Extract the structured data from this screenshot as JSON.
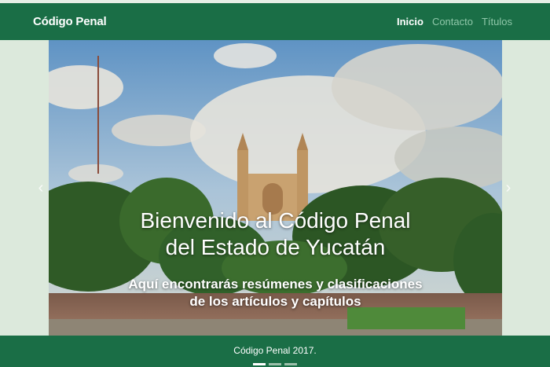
{
  "navbar": {
    "brand": "Código Penal",
    "links": [
      {
        "label": "Inicio",
        "active": true
      },
      {
        "label": "Contacto",
        "active": false
      },
      {
        "label": "Títulos",
        "active": false
      }
    ]
  },
  "carousel": {
    "title_line1": "Bienvenido al Código Penal",
    "title_line2": "del Estado de Yucatán",
    "subtitle_line1": "Aquí encontrarás resúmenes y clasificaciones",
    "subtitle_line2": "de los artículos y capítulos",
    "prev_icon": "‹",
    "next_icon": "›",
    "slide_count": 3,
    "active_slide": 1
  },
  "footer": {
    "text": "Código Penal 2017."
  },
  "colors": {
    "primary": "#1a6e46",
    "background": "#dce9dc",
    "nav_inactive": "#8fc7a9"
  }
}
